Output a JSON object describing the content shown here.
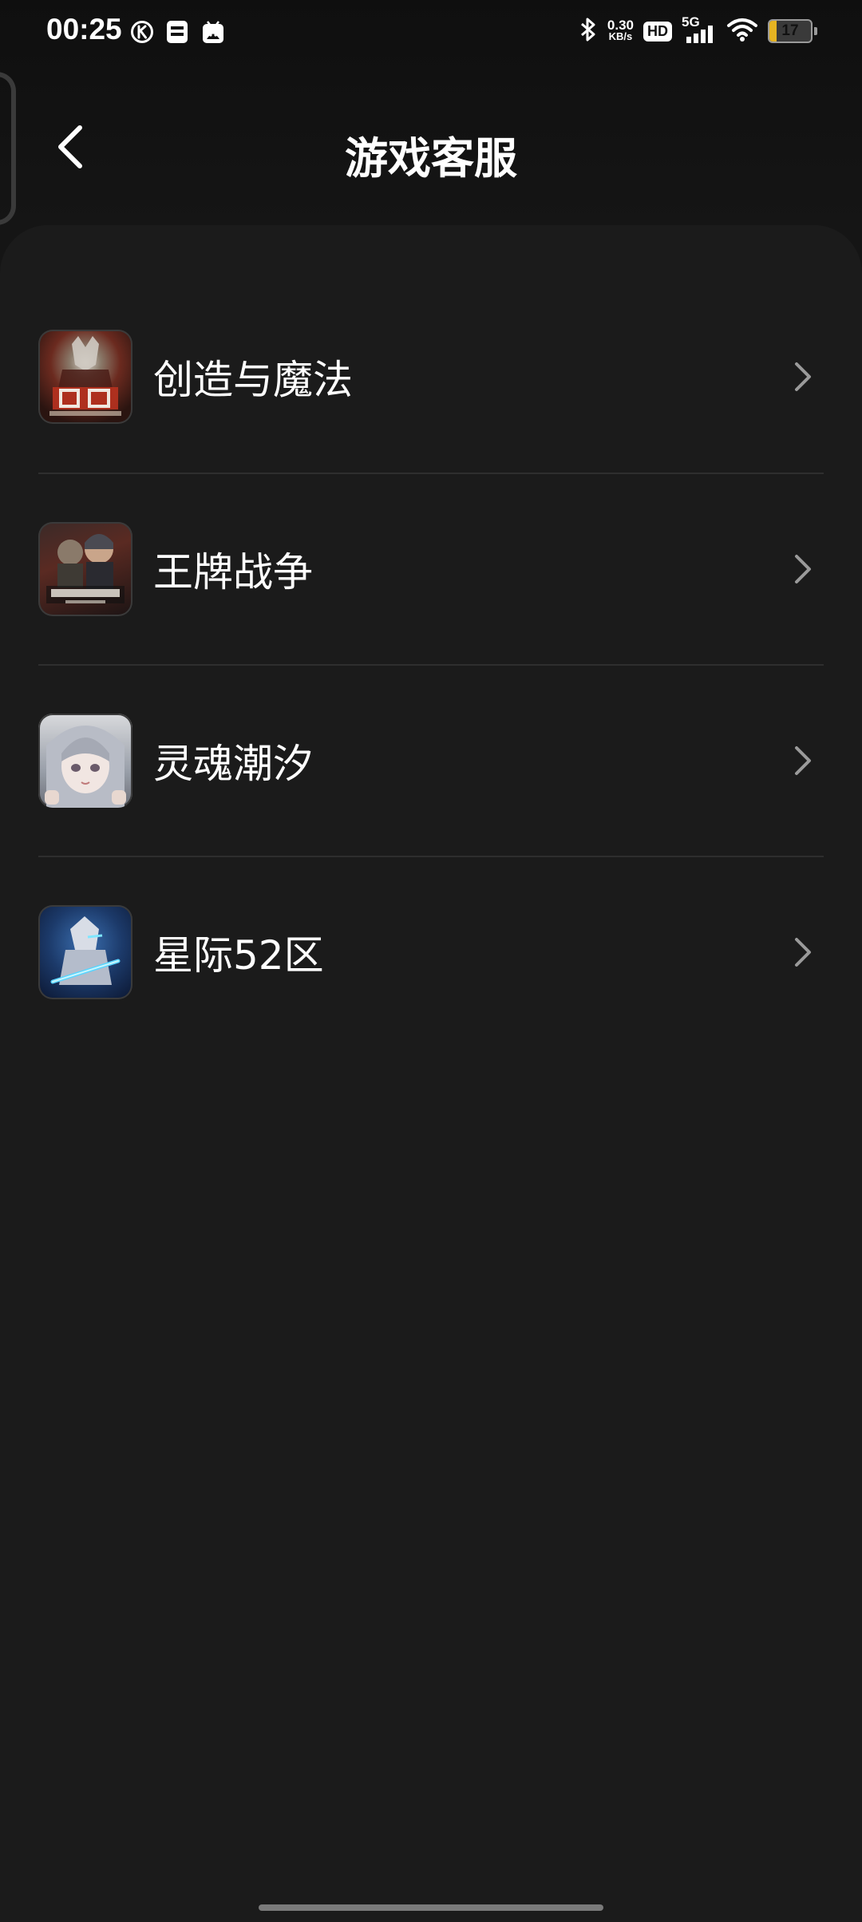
{
  "status_bar": {
    "time": "00:25",
    "net_speed_value": "0.30",
    "net_speed_unit": "KB/s",
    "hd_label": "HD",
    "network_label": "5G",
    "battery_level": "17",
    "icons": [
      "k-circle-icon",
      "sim-card-icon",
      "robot-icon",
      "bluetooth-icon",
      "signal-icon",
      "wifi-icon",
      "battery-icon"
    ]
  },
  "header": {
    "title": "游戏客服",
    "back_icon": "chevron-left-icon"
  },
  "games": [
    {
      "name": "创造与魔法",
      "icon": "creation-magic-game-icon"
    },
    {
      "name": "王牌战争",
      "icon": "ace-war-game-icon"
    },
    {
      "name": "灵魂潮汐",
      "icon": "soul-tide-game-icon"
    },
    {
      "name": "星际52区",
      "icon": "area52-game-icon"
    }
  ],
  "colors": {
    "background": "#1b1b1b",
    "divider": "#2e2e2e",
    "text": "#ffffff",
    "chevron": "#9a9a9a",
    "battery": "#e6b422"
  }
}
